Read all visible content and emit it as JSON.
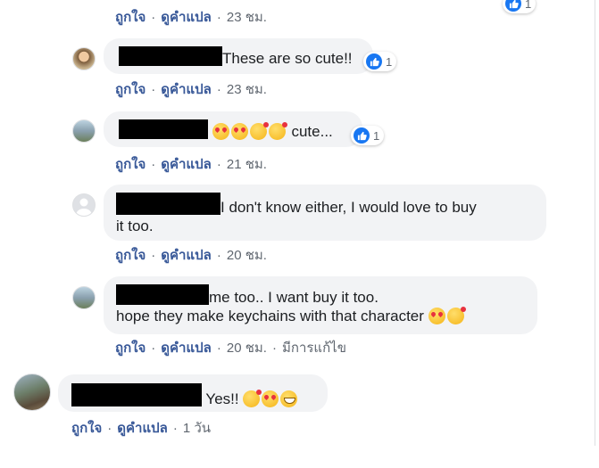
{
  "ui": {
    "like_label": "ถูกใจ",
    "translate_label": "ดูคำแปล",
    "edited_label": "มีการแก้ไข",
    "separator": "·"
  },
  "top_reaction_count": "1",
  "comments": [
    {
      "time": "23 ชม."
    },
    {
      "text": "These are so cute!!",
      "reaction_count": "1",
      "time": "23 ชม."
    },
    {
      "text": " cute...",
      "reaction_count": "1",
      "time": "21 ชม."
    },
    {
      "text_line1": "I don't know either, I would love to buy",
      "text_line2": "it too.",
      "time": "20 ชม."
    },
    {
      "text_line1": "me too.. I want buy it too.",
      "text_line2": "hope they make keychains with that character",
      "time": "20 ชม."
    },
    {
      "text": "Yes!!",
      "time": "1 วัน"
    }
  ],
  "colors": {
    "action_link": "#385898",
    "meta_text": "#606770",
    "bubble_bg": "#f2f3f5",
    "like_blue": "#1877f2"
  },
  "icons": [
    "like-icon",
    "heart-eyes-emoji",
    "kissing-heart-emoji",
    "grinning-emoji",
    "default-avatar-icon"
  ]
}
